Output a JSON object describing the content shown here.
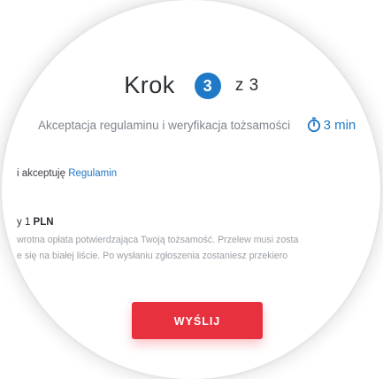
{
  "step": {
    "label": "Krok",
    "current": "3",
    "of_text": "z 3"
  },
  "subtitle": {
    "text": "Akceptacja regulaminu i weryfikacja tożsamości",
    "timer_text": "3 min",
    "timer_icon": "stopwatch-icon"
  },
  "terms": {
    "prefix": "i akceptuję",
    "link_text": "Regulamin"
  },
  "fee": {
    "title_prefix": "y 1",
    "title_amount": "PLN",
    "line1": "wrotna opłata potwierdzająca Twoją tożsamość. Przelew musi zosta",
    "line2": "e się na białej liście. Po wysłaniu zgłoszenia zostaniesz przekiero"
  },
  "submit": {
    "label": "WYŚLIJ"
  },
  "colors": {
    "accent_blue": "#1f79c7",
    "submit_red": "#e8313f",
    "text_dark": "#2b2e33",
    "text_muted": "#7e858d"
  }
}
